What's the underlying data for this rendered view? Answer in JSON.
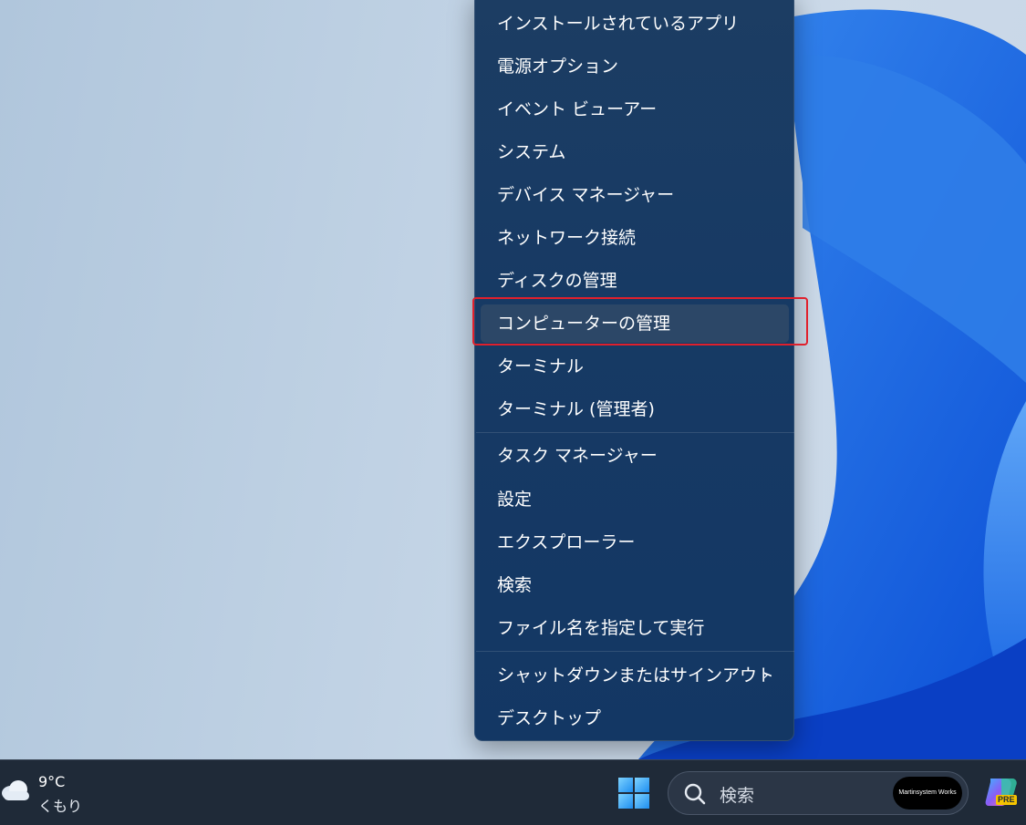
{
  "context_menu": {
    "items": [
      {
        "label": "インストールされているアプリ"
      },
      {
        "label": "電源オプション"
      },
      {
        "label": "イベント ビューアー"
      },
      {
        "label": "システム"
      },
      {
        "label": "デバイス マネージャー"
      },
      {
        "label": "ネットワーク接続"
      },
      {
        "label": "ディスクの管理"
      },
      {
        "label": "コンピューターの管理",
        "highlighted": true
      },
      {
        "label": "ターミナル"
      },
      {
        "label": "ターミナル (管理者)"
      },
      {
        "label": "タスク マネージャー"
      },
      {
        "label": "設定"
      },
      {
        "label": "エクスプローラー"
      },
      {
        "label": "検索"
      },
      {
        "label": "ファイル名を指定して実行"
      },
      {
        "label": "シャットダウンまたはサインアウト",
        "has_submenu": true,
        "submenu_indicator": "›"
      },
      {
        "label": "デスクトップ"
      }
    ],
    "highlight_color": "#e0202c"
  },
  "taskbar": {
    "weather": {
      "temperature": "9°C",
      "condition": "くもり",
      "icon": "cloud-icon"
    },
    "start_icon": "windows-logo-icon",
    "search": {
      "placeholder": "検索",
      "icon": "search-icon",
      "badge_text": "Martinsystem Works"
    },
    "copilot": {
      "icon": "copilot-icon",
      "badge": "PRE"
    }
  },
  "colors": {
    "menu_background": "#173a64",
    "taskbar_background": "#1f2a38",
    "accent_blue": "#1f6fe0"
  }
}
